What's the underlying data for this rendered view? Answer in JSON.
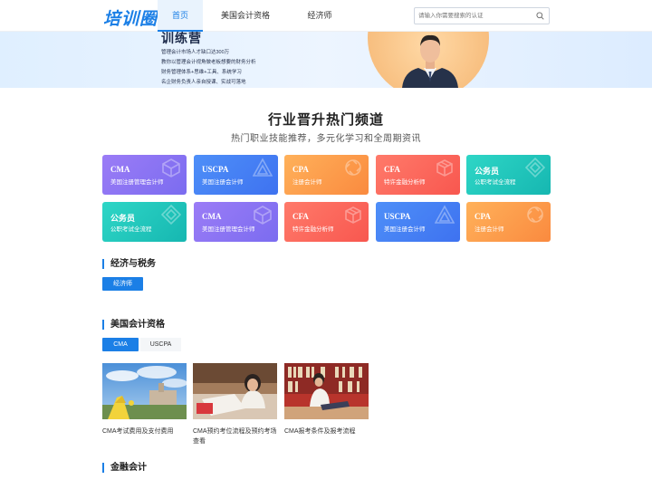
{
  "header": {
    "logo": "培训圈",
    "nav": [
      {
        "label": "首页",
        "active": true
      },
      {
        "label": "美国会计资格",
        "active": false
      },
      {
        "label": "经济师",
        "active": false
      }
    ],
    "search_placeholder": "请输入你需要搜索的认证"
  },
  "banner": {
    "title": "训练营",
    "lines": [
      "管理会计市场人才缺口达300万",
      "教你以管理会计视角做老板想要的财务分析",
      "财务管理体系+思维+工具、系统学习",
      "名企财务负责人亲自授课、实战可落地"
    ]
  },
  "hot": {
    "title": "行业晋升热门频道",
    "subtitle": "热门职业技能推荐，多元化学习和全周期资讯"
  },
  "cards": [
    {
      "title": "CMA",
      "subtitle": "美国注册管理会计师",
      "gradient": "g-purple",
      "icon": "cube-icon"
    },
    {
      "title": "USCPA",
      "subtitle": "美国注册会计师",
      "gradient": "g-blue",
      "icon": "triangle-icon"
    },
    {
      "title": "CPA",
      "subtitle": "注册会计师",
      "gradient": "g-orange",
      "icon": "cycle-icon"
    },
    {
      "title": "CFA",
      "subtitle": "特许金融分析师",
      "gradient": "g-red",
      "icon": "box-icon"
    },
    {
      "title": "公务员",
      "subtitle": "公职考试全流程",
      "gradient": "g-teal",
      "icon": "diamond-icon"
    },
    {
      "title": "公务员",
      "subtitle": "公职考试全流程",
      "gradient": "g-teal",
      "icon": "diamond-icon"
    },
    {
      "title": "CMA",
      "subtitle": "美国注册管理会计师",
      "gradient": "g-purple",
      "icon": "cube-icon"
    },
    {
      "title": "CFA",
      "subtitle": "特许金融分析师",
      "gradient": "g-red",
      "icon": "box-icon"
    },
    {
      "title": "USCPA",
      "subtitle": "美国注册会计师",
      "gradient": "g-blue",
      "icon": "triangle-icon"
    },
    {
      "title": "CPA",
      "subtitle": "注册会计师",
      "gradient": "g-orange",
      "icon": "cycle-icon"
    }
  ],
  "section_econ": {
    "title": "经济与税务",
    "button": "经济师"
  },
  "section_us": {
    "title": "美国会计资格",
    "tabs": [
      {
        "label": "CMA",
        "active": true
      },
      {
        "label": "USCPA",
        "active": false
      }
    ],
    "articles": [
      {
        "caption": "CMA考试费用及支付费用"
      },
      {
        "caption": "CMA预约考位流程及预约考场查看"
      },
      {
        "caption": "CMA报考条件及报考流程"
      }
    ]
  },
  "section_finance": {
    "title": "金融会计"
  }
}
